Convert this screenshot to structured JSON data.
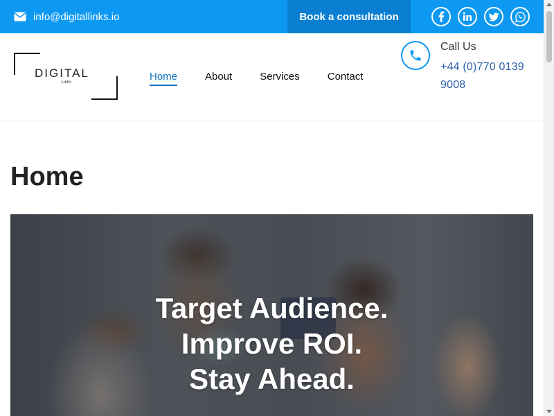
{
  "topbar": {
    "email": "info@digitallinks.io",
    "book_label": "Book a consultation",
    "socials": [
      {
        "icon": "facebook-icon",
        "glyph": "f"
      },
      {
        "icon": "linkedin-icon",
        "glyph": "in"
      },
      {
        "icon": "twitter-icon",
        "glyph": "t"
      },
      {
        "icon": "whatsapp-icon",
        "glyph": "w"
      }
    ]
  },
  "header": {
    "logo": {
      "word": "DIGITAL",
      "sub": "Links"
    },
    "nav": [
      {
        "label": "Home",
        "active": true
      },
      {
        "label": "About",
        "active": false
      },
      {
        "label": "Services",
        "active": false
      },
      {
        "label": "Contact",
        "active": false
      }
    ],
    "call_label": "Call Us",
    "phone": "+44 (0)770 0139 9008"
  },
  "page": {
    "title": "Home",
    "hero_lines": [
      "Target Audience.",
      "Improve ROI.",
      "Stay Ahead."
    ]
  },
  "colors": {
    "topbar": "#0d99f2",
    "book_button": "#0a7fd2",
    "nav_active": "#0a6fbf",
    "phone_text": "#2a5fa8"
  }
}
